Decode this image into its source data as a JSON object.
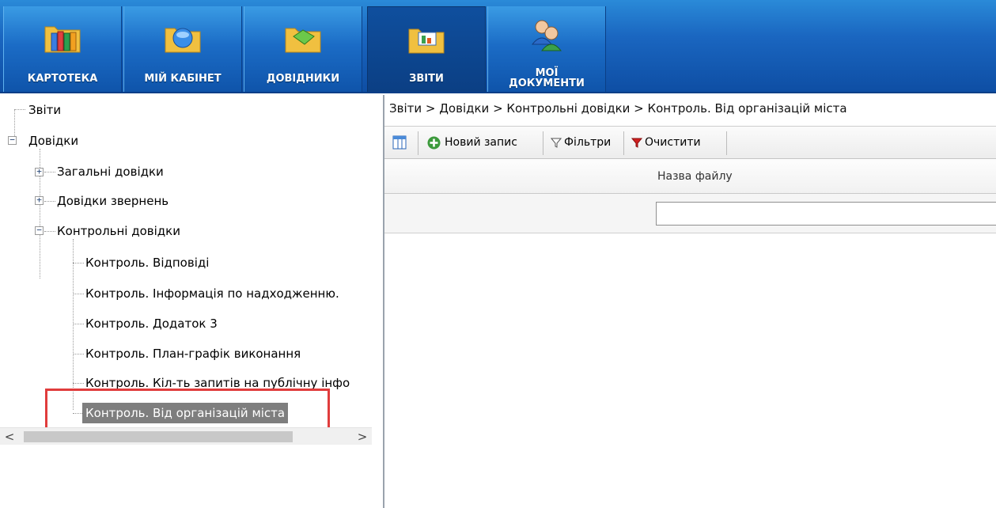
{
  "nav": {
    "tabs": [
      {
        "label": "КАРТОТЕКА",
        "icon": "folders-icon"
      },
      {
        "label": "МІЙ КАБІНЕТ",
        "icon": "cabinet-icon"
      },
      {
        "label": "ДОВІДНИКИ",
        "icon": "directories-icon"
      },
      {
        "label": "ЗВІТИ",
        "icon": "reports-icon",
        "active": true
      },
      {
        "label_line1": "МОЇ",
        "label_line2": "ДОКУМЕНТИ",
        "icon": "users-icon"
      }
    ]
  },
  "tree": {
    "nodes": [
      {
        "label": "Звіти"
      },
      {
        "label": "Довідки",
        "expanded": true
      },
      {
        "label": "Загальні довідки",
        "expanded": false
      },
      {
        "label": "Довідки звернень",
        "expanded": false
      },
      {
        "label": "Контрольні довідки",
        "expanded": true
      },
      {
        "label": "Контроль. Відповіді"
      },
      {
        "label": "Контроль. Інформація по надходженню."
      },
      {
        "label": "Контроль. Додаток 3"
      },
      {
        "label": "Контроль. План-графік виконання"
      },
      {
        "label": "Контроль. Кіл-ть запитів на публічну інфо"
      },
      {
        "label": "Контроль. Від організацій міста",
        "selected": true
      }
    ],
    "scroll_left": "<",
    "scroll_right": ">"
  },
  "breadcrumb": "Звіти > Довідки > Контрольні довідки > Контроль. Від організацій міста",
  "toolbar": {
    "new_record": "Новий запис",
    "filters": "Фільтри",
    "clear": "Очистити"
  },
  "grid": {
    "column_header": "Назва файлу",
    "filter_value": ""
  },
  "colors": {
    "nav_blue": "#1b6cc6",
    "selection": "#7e7e7e",
    "highlight": "#e03c3c",
    "add_green": "#3c9a3c",
    "clear_red": "#d12020"
  }
}
